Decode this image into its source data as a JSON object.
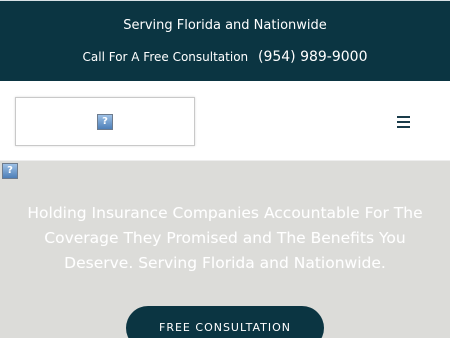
{
  "topbar": {
    "tagline": "Serving Florida and Nationwide",
    "consult_label": "Call For A Free Consultation",
    "phone": "(954) 989-9000"
  },
  "header": {
    "logo_icon": "broken-image-icon",
    "menu_icon": "hamburger-menu-icon"
  },
  "hero": {
    "image_icon": "broken-image-icon",
    "headline": "Holding Insurance Companies Accountable For The Coverage They Promised and The Benefits You Deserve. Serving Florida and Nationwide.",
    "cta_label": "FREE CONSULTATION"
  },
  "colors": {
    "brand_dark": "#0b3542",
    "hero_bg": "#dcdcd9",
    "text_light": "#ffffff"
  }
}
